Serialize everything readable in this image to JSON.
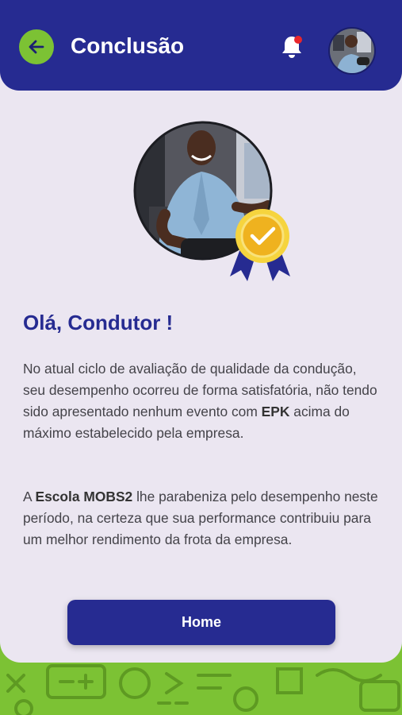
{
  "header": {
    "title": "Conclusão",
    "back_icon": "arrow-left-icon",
    "notification_icon": "bell-icon",
    "notification_dot_color": "#e8262c"
  },
  "hero": {
    "badge_icon": "award-check-icon"
  },
  "content": {
    "greeting": "Olá, Condutor !",
    "paragraph1": {
      "before": "No atual ciclo de avaliação de qualidade da condução, seu desempenho ocorreu de forma satisfatória, não tendo sido apresentado nenhum evento com ",
      "bold": "EPK",
      "after": " acima do máximo estabelecido pela empresa."
    },
    "paragraph2": {
      "before": "A ",
      "bold": "Escola MOBS2",
      "after": " lhe parabeniza pelo desempenho neste período, na certeza que sua performance contribuiu para um melhor rendimento da frota da empresa."
    }
  },
  "actions": {
    "home_label": "Home"
  },
  "colors": {
    "primary": "#262b91",
    "accent": "#7cc234",
    "background": "#ebe6f1",
    "badge_gold": "#f4c430"
  }
}
